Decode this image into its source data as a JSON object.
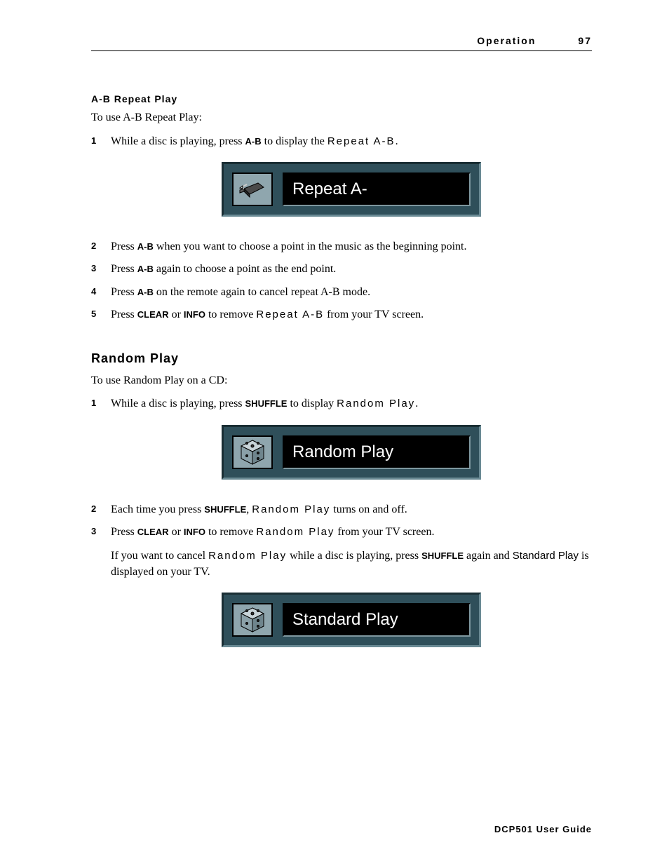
{
  "header": {
    "chapter": "Operation",
    "page": "97"
  },
  "section1": {
    "title": "A-B Repeat Play",
    "intro": "To use A-B Repeat Play:",
    "steps": {
      "s1": {
        "t1": "While a disc is playing, press ",
        "b1": "A-B",
        "t2": " to display the ",
        "l1": "Repeat A-B",
        "t3": "."
      },
      "s2": {
        "t1": "Press ",
        "b1": "A-B",
        "t2": " when you want to choose a point in the music as the beginning point."
      },
      "s3": {
        "t1": "Press ",
        "b1": "A-B",
        "t2": " again to choose a point as the end point."
      },
      "s4": {
        "t1": "Press ",
        "b1": "A-B",
        "t2": " on the remote again to cancel repeat A-B mode."
      },
      "s5": {
        "t1": "Press ",
        "b1": "CLEAR",
        "t2": " or ",
        "b2": "INFO",
        "t3": " to remove ",
        "l1": "Repeat A-B",
        "t4": " from your TV screen."
      }
    },
    "osd": "Repeat A-"
  },
  "section2": {
    "title": "Random Play",
    "intro": "To use Random Play on a CD:",
    "steps": {
      "s1": {
        "t1": "While a disc is playing, press ",
        "b1": "SHUFFLE",
        "t2": " to display ",
        "l1": "Random Play",
        "t3": "."
      },
      "s2": {
        "t1": "Each time you press ",
        "b1": "SHUFFLE",
        "t2": ", ",
        "l1": "Random Play",
        "t3": " turns on and off."
      },
      "s3": {
        "t1": "Press ",
        "b1": "CLEAR",
        "t2": " or ",
        "b2": "INFO",
        "t3": " to remove ",
        "l1": "Random Play",
        "t4": " from your TV screen."
      }
    },
    "note": {
      "t1": "If you want to cancel ",
      "l1": "Random Play",
      "t2": " while a disc is playing, press ",
      "b1": "SHUFFLE",
      "t3": " again and ",
      "l2": "Standard Play",
      "t4": " is displayed on your TV."
    },
    "osd1": "Random Play",
    "osd2": "Standard Play"
  },
  "footer": "DCP501 User Guide"
}
